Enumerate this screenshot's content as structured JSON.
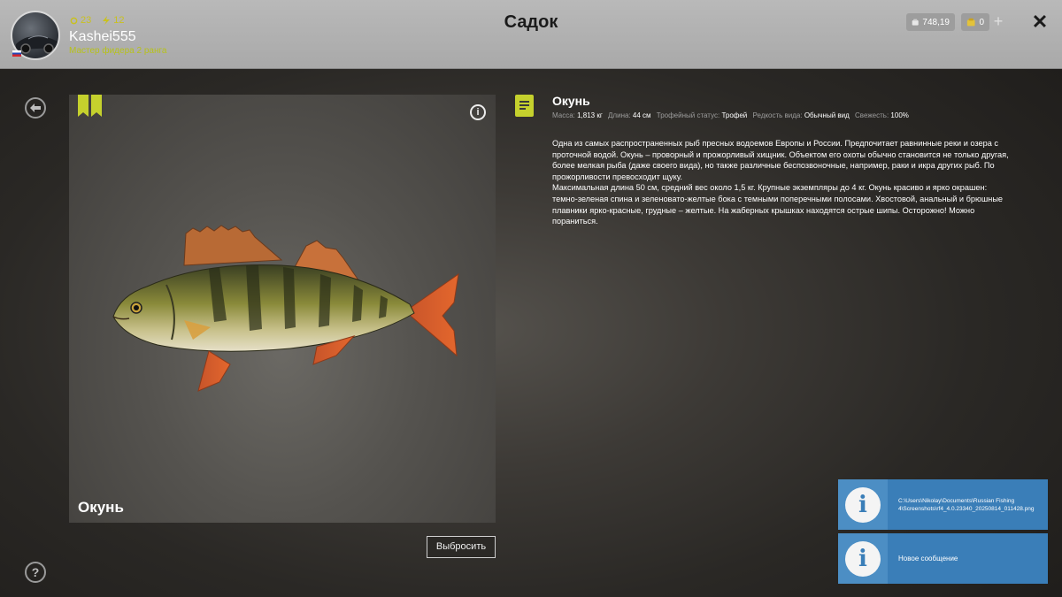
{
  "header": {
    "title": "Садок",
    "username": "Kashei555",
    "rank": "Мастер фидера 2 ранга",
    "level": "23",
    "experience_rank": "12",
    "silver": "748,19",
    "gold": "0",
    "add_label": "+",
    "close_label": "✕"
  },
  "nav": {
    "back_icon": "back-arrow-icon",
    "help_label": "?"
  },
  "fish": {
    "name": "Окунь",
    "info_label": "i",
    "colors": {
      "accent": "#c5d12d",
      "toast": "#3a7eb8"
    }
  },
  "details": {
    "title": "Окунь",
    "mass_label": "Масса:",
    "mass_value": "1,813 кг",
    "length_label": "Длина:",
    "length_value": "44 см",
    "trophy_label": "Трофейный статус:",
    "trophy_value": "Трофей",
    "rarity_label": "Редкость вида:",
    "rarity_value": "Обычный вид",
    "freshness_label": "Свежесть:",
    "freshness_value": "100%",
    "description_1": "Одна из самых распространенных рыб пресных водоемов Европы и России. Предпочитает равнинные реки и озера с проточной водой. Окунь – проворный и прожорливый хищник. Объектом его охоты обычно становится не только другая, более мелкая рыба (даже своего вида), но также различные беспозвоночные, например, раки и икра других рыб. По прожорливости превосходит щуку.",
    "description_2": "Максимальная длина 50 см, средний вес около 1,5 кг. Крупные экземпляры до 4 кг. Окунь красиво и ярко окрашен: темно-зеленая спина и зеленовато-желтые бока с темными поперечными полосами. Хвостовой, анальный и брюшные плавники ярко-красные, грудные – желтые. На жаберных крышках находятся острые шипы. Осторожно! Можно пораниться."
  },
  "actions": {
    "discard_label": "Выбросить"
  },
  "notifications": [
    {
      "icon": "info-icon",
      "text": "C:\\Users\\Nikolay\\Documents\\Russian Fishing 4\\Screenshots\\rf4_4.0.23340_20250814_011428.png"
    },
    {
      "icon": "info-icon",
      "text": "Новое сообщение"
    }
  ]
}
